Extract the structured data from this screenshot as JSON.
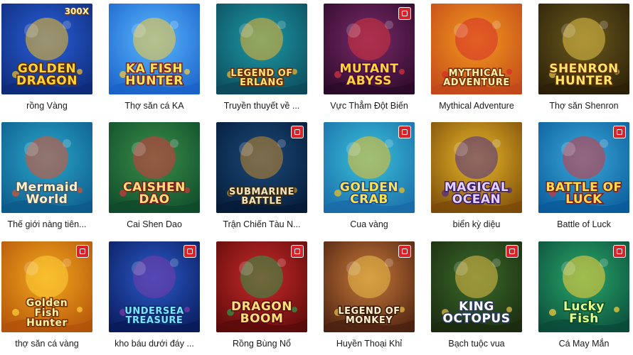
{
  "games": [
    {
      "caption": "rồng Vàng",
      "art": "GOLDEN\nDRAGON",
      "badge": "300X",
      "colors": {
        "bg1": "#2a5fd8",
        "bg2": "#0e2a78",
        "accent": "#f5c021",
        "text": "#ffd43a",
        "stroke": "#5a2a00"
      }
    },
    {
      "caption": "Thợ săn cá KA",
      "art": "KA FISH HUNTER",
      "badge": "",
      "colors": {
        "bg1": "#5ab8ff",
        "bg2": "#1a62c8",
        "accent": "#ffcc33",
        "text": "#ffe45a",
        "stroke": "#7a1f1f"
      }
    },
    {
      "caption": "Truyền thuyết về ...",
      "art": "LEGEND OF ERLANG",
      "badge": "",
      "colors": {
        "bg1": "#1e9aa6",
        "bg2": "#0c4a5a",
        "accent": "#f1b52e",
        "text": "#ffe17a",
        "stroke": "#6a2a00"
      }
    },
    {
      "caption": "Vực Thẳm Đột Biến",
      "art": "MUTANT\nABYSS",
      "badge": "",
      "colors": {
        "bg1": "#7a2a6a",
        "bg2": "#2a0a28",
        "accent": "#d8343c",
        "text": "#ffd63a",
        "stroke": "#4a0a3a"
      }
    },
    {
      "caption": "Mythical Adventure",
      "art": "MYTHICAL\nADVENTURE",
      "badge": "",
      "colors": {
        "bg1": "#f29a1e",
        "bg2": "#c2471a",
        "accent": "#d62b2b",
        "text": "#fff0b4",
        "stroke": "#7a2f00"
      }
    },
    {
      "caption": "Thợ săn Shenron",
      "art": "SHENRON\nHUNTER",
      "badge": "",
      "colors": {
        "bg1": "#6b5a1e",
        "bg2": "#2a1f08",
        "accent": "#e6c54a",
        "text": "#ffe36a",
        "stroke": "#5a3000"
      }
    },
    {
      "caption": "Thế giới nàng tiên...",
      "art": "Mermaid\nWorld",
      "badge": "",
      "colors": {
        "bg1": "#2aa6c8",
        "bg2": "#0d5a8a",
        "accent": "#e4502a",
        "text": "#fff0c0",
        "stroke": "#3a5a7a"
      }
    },
    {
      "caption": "Cai Shen Dao",
      "art": "CAISHEN\nDAO",
      "badge": "",
      "colors": {
        "bg1": "#3a8f4a",
        "bg2": "#0f4a2a",
        "accent": "#d8343c",
        "text": "#ffe07a",
        "stroke": "#7a1a1a"
      }
    },
    {
      "caption": "Trận Chiến Tàu N...",
      "art": "SUBMARINE\nBATTLE",
      "badge": "",
      "colors": {
        "bg1": "#1a4a7a",
        "bg2": "#061a36",
        "accent": "#c8882a",
        "text": "#f2e4c0",
        "stroke": "#3a2a10"
      }
    },
    {
      "caption": "Cua vàng",
      "art": "GOLDEN\nCRAB",
      "badge": "",
      "colors": {
        "bg1": "#3ac2d8",
        "bg2": "#1a6aa8",
        "accent": "#f5c021",
        "text": "#ffe14a",
        "stroke": "#1a4a8a"
      }
    },
    {
      "caption": "biển kỳ diệu",
      "art": "MAGICAL\nOCEAN",
      "badge": "",
      "colors": {
        "bg1": "#e8b82a",
        "bg2": "#7a4a0a",
        "accent": "#4a2a8a",
        "text": "#e2d4ff",
        "stroke": "#3a1a6a"
      }
    },
    {
      "caption": "Battle of Luck",
      "art": "BATTLE OF LUCK",
      "badge": "",
      "colors": {
        "bg1": "#3aa8d8",
        "bg2": "#0a5a9a",
        "accent": "#d8343c",
        "text": "#ffe04a",
        "stroke": "#7a1a1a"
      }
    },
    {
      "caption": "thợ săn cá vàng",
      "art": "Golden\nFish\nHunter",
      "badge": "",
      "colors": {
        "bg1": "#f2a81e",
        "bg2": "#b2520a",
        "accent": "#ffd23a",
        "text": "#fff3a8",
        "stroke": "#7a3000"
      }
    },
    {
      "caption": "kho báu dưới đáy ...",
      "art": "UNDERSEA\nTREASURE",
      "badge": "",
      "colors": {
        "bg1": "#2a5ac8",
        "bg2": "#0a1a5a",
        "accent": "#7a3aa8",
        "text": "#7ae6ff",
        "stroke": "#0a2a6a"
      }
    },
    {
      "caption": "Rồng Bùng Nổ",
      "art": "DRAGON\nBOOM",
      "badge": "",
      "colors": {
        "bg1": "#c82a2a",
        "bg2": "#5a0a0a",
        "accent": "#2a9a4a",
        "text": "#ffe07a",
        "stroke": "#5a0a0a"
      }
    },
    {
      "caption": "Huyền Thoại Khỉ",
      "art": "LEGEND OF\nMONKEY",
      "badge": "",
      "colors": {
        "bg1": "#c87a3a",
        "bg2": "#4a2010",
        "accent": "#e8c04a",
        "text": "#fff0d0",
        "stroke": "#3a1a08"
      }
    },
    {
      "caption": "Bạch tuộc vua",
      "art": "KING\nOCTOPUS",
      "badge": "",
      "colors": {
        "bg1": "#3a6a2a",
        "bg2": "#1a2a10",
        "accent": "#e8c04a",
        "text": "#ffffff",
        "stroke": "#2a3a5a"
      }
    },
    {
      "caption": "Cá May Mắn",
      "art": "Lucky\nFish",
      "badge": "",
      "colors": {
        "bg1": "#2aa86a",
        "bg2": "#0a4a3a",
        "accent": "#ffd23a",
        "text": "#e6ff8a",
        "stroke": "#0a4a2a"
      }
    }
  ]
}
